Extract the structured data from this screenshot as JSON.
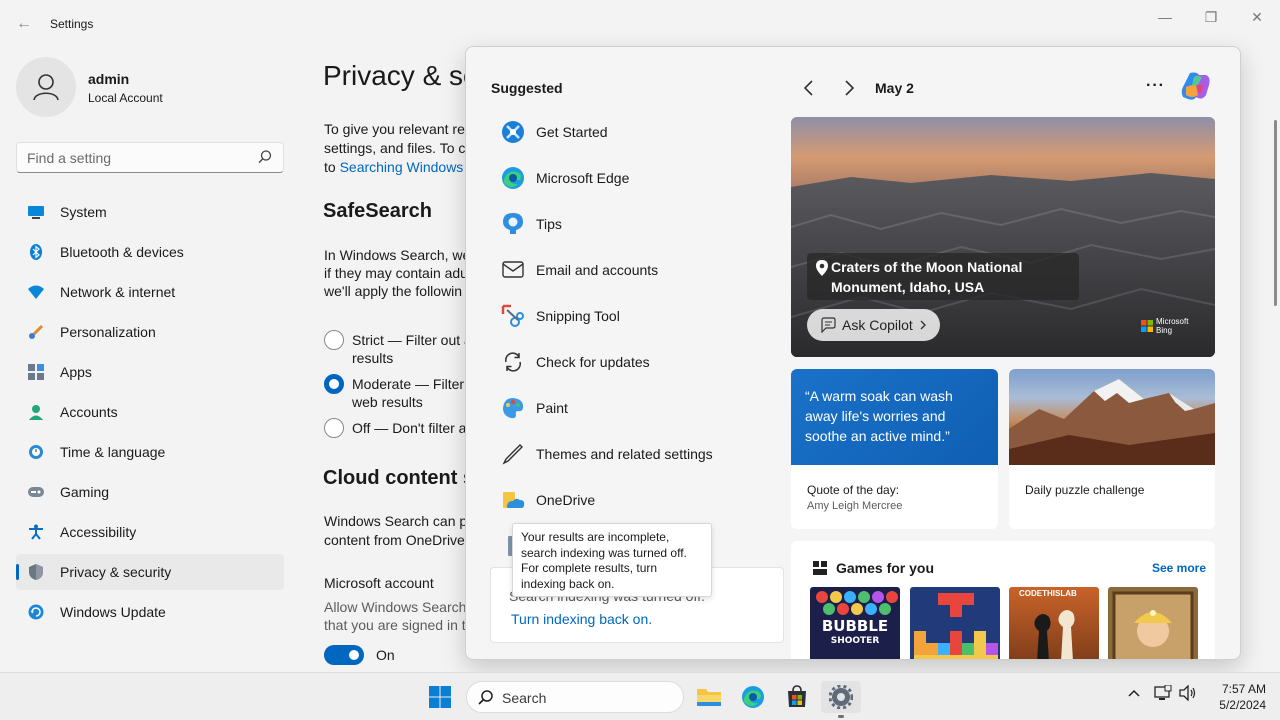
{
  "window": {
    "title": "Settings",
    "back": "←",
    "minimize": "—",
    "restore": "❐",
    "close": "✕"
  },
  "profile": {
    "name": "admin",
    "subtitle": "Local Account"
  },
  "search": {
    "placeholder": "Find a setting"
  },
  "nav": {
    "items": [
      {
        "label": "System",
        "icon": "system-icon"
      },
      {
        "label": "Bluetooth & devices",
        "icon": "bluetooth-icon"
      },
      {
        "label": "Network & internet",
        "icon": "wifi-icon"
      },
      {
        "label": "Personalization",
        "icon": "brush-icon"
      },
      {
        "label": "Apps",
        "icon": "apps-icon"
      },
      {
        "label": "Accounts",
        "icon": "person-icon"
      },
      {
        "label": "Time & language",
        "icon": "clock-globe-icon"
      },
      {
        "label": "Gaming",
        "icon": "gamepad-icon"
      },
      {
        "label": "Accessibility",
        "icon": "accessibility-icon"
      },
      {
        "label": "Privacy & security",
        "icon": "shield-icon",
        "selected": true
      },
      {
        "label": "Windows Update",
        "icon": "update-icon"
      }
    ]
  },
  "content": {
    "page_title": "Privacy & se",
    "intro_line1": "To give you relevant res",
    "intro_line2": "settings, and files. To ch",
    "intro_line3_prefix": "to ",
    "intro_link": "Searching Windows",
    "safesearch_heading": "SafeSearch",
    "safesearch_line1": "In Windows Search, we",
    "safesearch_line2": "if they may contain adu",
    "safesearch_line3": "we'll apply the followin",
    "radio_strict_1": "Strict — Filter out a",
    "radio_strict_2": "results",
    "radio_moderate_1": "Moderate — Filter",
    "radio_moderate_2": "web results",
    "radio_off": "Off — Don't filter a",
    "cloud_heading": "Cloud content s",
    "cloud_line1": "Windows Search can pe",
    "cloud_line2": "content from OneDrive",
    "ms_account": "Microsoft account",
    "ms_account_line1": "Allow Windows Search",
    "ms_account_line2": "that you are signed in t",
    "toggle_label": "On"
  },
  "flyout": {
    "suggested_title": "Suggested",
    "suggested": [
      {
        "label": "Get Started",
        "icon": "get-started-icon"
      },
      {
        "label": "Microsoft Edge",
        "icon": "edge-icon"
      },
      {
        "label": "Tips",
        "icon": "tips-icon"
      },
      {
        "label": "Email and accounts",
        "icon": "mail-icon"
      },
      {
        "label": "Snipping Tool",
        "icon": "snipping-tool-icon"
      },
      {
        "label": "Check for updates",
        "icon": "refresh-icon"
      },
      {
        "label": "Paint",
        "icon": "paint-icon"
      },
      {
        "label": "Themes and related settings",
        "icon": "pen-icon"
      },
      {
        "label": "OneDrive",
        "icon": "onedrive-icon"
      }
    ],
    "tooltip_lines": [
      "Your results are incomplete,",
      "search indexing was turned off.",
      "For complete results, turn",
      "indexing back on."
    ],
    "index_notice": "Search indexing was turned off.",
    "index_link": "Turn indexing back on.",
    "date": "May 2",
    "more": "···",
    "hero": {
      "caption_line1": "Craters of the Moon National",
      "caption_line2": "Monument, Idaho, USA",
      "ask_copilot": "Ask Copilot",
      "bing_line1": "Microsoft",
      "bing_line2": "Bing"
    },
    "quote": {
      "text_line1": "“A warm soak can wash",
      "text_line2": "away life's worries and",
      "text_line3": "soothe an active mind.”",
      "label": "Quote of the day:",
      "author": "Amy Leigh Mercree"
    },
    "puzzle": {
      "label": "Daily puzzle challenge"
    },
    "games": {
      "title": "Games for you",
      "see_more": "See more",
      "tile1_line1": "BUBBLE",
      "tile1_line2": "SHOOTER",
      "tile3_label": "CODETHISLAB"
    }
  },
  "taskbar": {
    "search_placeholder": "Search",
    "time": "7:57 AM",
    "date": "5/2/2024"
  },
  "colors": {
    "accent": "#0067c0",
    "background": "#f3f3f3",
    "flyout_bg": "#f5f5f5"
  }
}
